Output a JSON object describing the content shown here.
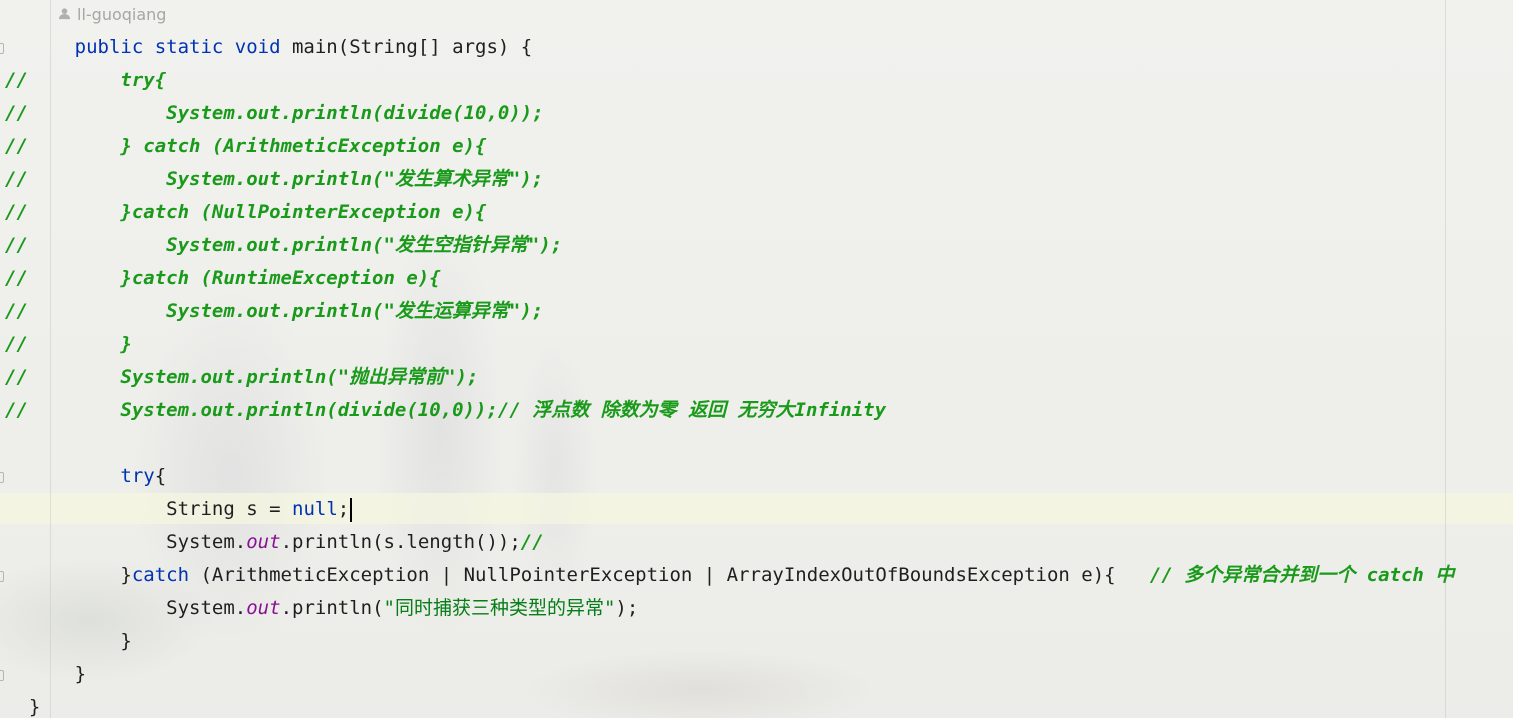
{
  "editor": {
    "author": "ll-guoqiang",
    "lines": [
      {
        "prefix": "",
        "indent": "    ",
        "parts": [
          {
            "t": "public static void ",
            "c": "kw"
          },
          {
            "t": "main",
            "c": "dim"
          },
          {
            "t": "(String[] args) {",
            "c": "dim"
          }
        ]
      },
      {
        "prefix": "//",
        "indent": "        ",
        "parts": [
          {
            "t": "try{",
            "c": "cm"
          }
        ]
      },
      {
        "prefix": "//",
        "indent": "            ",
        "parts": [
          {
            "t": "System.out.println(divide(10,0));",
            "c": "cm"
          }
        ]
      },
      {
        "prefix": "//",
        "indent": "        ",
        "parts": [
          {
            "t": "} catch (ArithmeticException e){",
            "c": "cm"
          }
        ]
      },
      {
        "prefix": "//",
        "indent": "            ",
        "parts": [
          {
            "t": "System.out.println(\"发生算术异常\");",
            "c": "cm"
          }
        ]
      },
      {
        "prefix": "//",
        "indent": "        ",
        "parts": [
          {
            "t": "}catch (NullPointerException e){",
            "c": "cm"
          }
        ]
      },
      {
        "prefix": "//",
        "indent": "            ",
        "parts": [
          {
            "t": "System.out.println(\"发生空指针异常\");",
            "c": "cm"
          }
        ]
      },
      {
        "prefix": "//",
        "indent": "        ",
        "parts": [
          {
            "t": "}catch (RuntimeException e){",
            "c": "cm"
          }
        ]
      },
      {
        "prefix": "//",
        "indent": "            ",
        "parts": [
          {
            "t": "System.out.println(\"发生运算异常\");",
            "c": "cm"
          }
        ]
      },
      {
        "prefix": "//",
        "indent": "        ",
        "parts": [
          {
            "t": "}",
            "c": "cm"
          }
        ]
      },
      {
        "prefix": "//",
        "indent": "        ",
        "parts": [
          {
            "t": "System.out.println(\"抛出异常前\");",
            "c": "cm"
          }
        ]
      },
      {
        "prefix": "//",
        "indent": "        ",
        "parts": [
          {
            "t": "System.out.println(divide(10,0));// 浮点数 除数为零 返回 无穷大Infinity",
            "c": "cm"
          }
        ]
      },
      {
        "prefix": "",
        "indent": "",
        "parts": []
      },
      {
        "prefix": "",
        "indent": "        ",
        "parts": [
          {
            "t": "try",
            "c": "kw"
          },
          {
            "t": "{",
            "c": "dim"
          }
        ]
      },
      {
        "prefix": "",
        "indent": "            ",
        "parts": [
          {
            "t": "String s = ",
            "c": "dim"
          },
          {
            "t": "null",
            "c": "kw"
          },
          {
            "t": ";",
            "c": "dim"
          }
        ],
        "caret": true
      },
      {
        "prefix": "",
        "indent": "            ",
        "parts": [
          {
            "t": "System.",
            "c": "dim"
          },
          {
            "t": "out",
            "c": "fld"
          },
          {
            "t": ".println(s.length());",
            "c": "dim"
          },
          {
            "t": "//",
            "c": "cm-n"
          }
        ]
      },
      {
        "prefix": "",
        "indent": "        ",
        "parts": [
          {
            "t": "}",
            "c": "dim"
          },
          {
            "t": "catch",
            "c": "kw"
          },
          {
            "t": " (ArithmeticException | NullPointerException | ArrayIndexOutOfBoundsException e){   ",
            "c": "dim"
          },
          {
            "t": "// 多个异常合并到一个 catch 中",
            "c": "cm"
          }
        ]
      },
      {
        "prefix": "",
        "indent": "            ",
        "parts": [
          {
            "t": "System.",
            "c": "dim"
          },
          {
            "t": "out",
            "c": "fld"
          },
          {
            "t": ".println(",
            "c": "dim"
          },
          {
            "t": "\"同时捕获三种类型的异常\"",
            "c": "str"
          },
          {
            "t": ");",
            "c": "dim"
          }
        ]
      },
      {
        "prefix": "",
        "indent": "        ",
        "parts": [
          {
            "t": "}",
            "c": "dim"
          }
        ]
      },
      {
        "prefix": "",
        "indent": "    ",
        "parts": [
          {
            "t": "}",
            "c": "dim"
          }
        ]
      },
      {
        "prefix": "",
        "indent": "",
        "parts": [
          {
            "t": "}",
            "c": "dim"
          }
        ]
      }
    ]
  }
}
